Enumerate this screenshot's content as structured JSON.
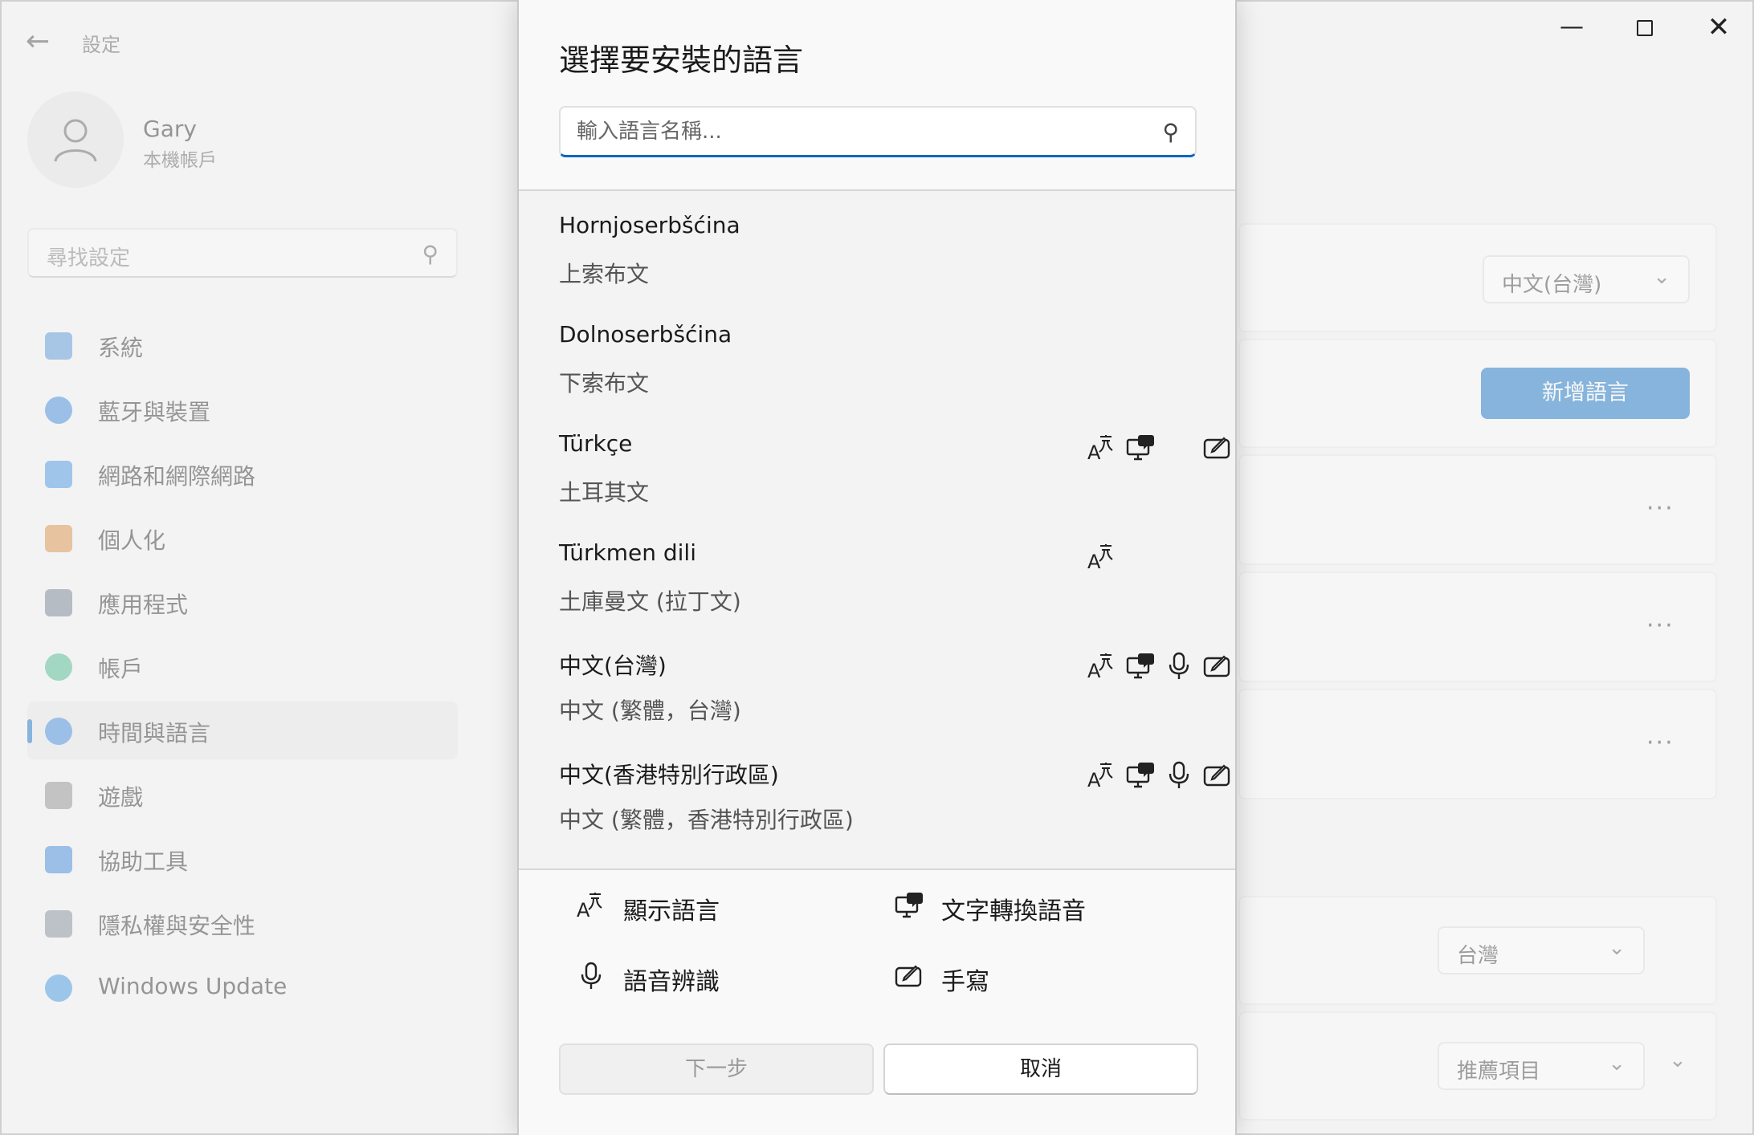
{
  "settings": {
    "title": "設定",
    "user": {
      "name": "Gary",
      "account": "本機帳戶"
    },
    "search_placeholder": "尋找設定",
    "nav": [
      {
        "label": "系統",
        "icon": "system-icon",
        "color": "#4a8fd6"
      },
      {
        "label": "藍牙與裝置",
        "icon": "bluetooth-icon",
        "color": "#2f7fd8"
      },
      {
        "label": "網路和網際網路",
        "icon": "wifi-icon",
        "color": "#3b8ee0"
      },
      {
        "label": "個人化",
        "icon": "brush-icon",
        "color": "#d88a3a"
      },
      {
        "label": "應用程式",
        "icon": "apps-icon",
        "color": "#6b7a8c"
      },
      {
        "label": "帳戶",
        "icon": "account-icon",
        "color": "#3fb58a"
      },
      {
        "label": "時間與語言",
        "icon": "time-language-icon",
        "color": "#2f7fd8"
      },
      {
        "label": "遊戲",
        "icon": "gamepad-icon",
        "color": "#8a8a8a"
      },
      {
        "label": "協助工具",
        "icon": "accessibility-icon",
        "color": "#2f7fd8"
      },
      {
        "label": "隱私權與安全性",
        "icon": "shield-icon",
        "color": "#7a8694"
      },
      {
        "label": "Windows Update",
        "icon": "update-icon",
        "color": "#2f8fe0"
      }
    ],
    "display_language_value": "中文(台灣)",
    "add_language_label": "新增語言",
    "region_value": "台灣",
    "format_value": "推薦項目",
    "more_label": "···"
  },
  "dialog": {
    "title": "選擇要安裝的語言",
    "search_placeholder": "輸入語言名稱...",
    "languages": [
      {
        "name": "Hornjoserbšćina",
        "sub": "上索布文",
        "features": []
      },
      {
        "name": "Dolnoserbšćina",
        "sub": "下索布文",
        "features": []
      },
      {
        "name": "Türkçe",
        "sub": "土耳其文",
        "features": [
          "display",
          "tts",
          "",
          "handwriting"
        ]
      },
      {
        "name": "Türkmen dili",
        "sub": "土庫曼文 (拉丁文)",
        "features": [
          "display"
        ]
      },
      {
        "name": "中文(台灣)",
        "sub": "中文 (繁體，台灣)",
        "features": [
          "display",
          "tts",
          "speech",
          "handwriting"
        ]
      },
      {
        "name": "中文(香港特別行政區)",
        "sub": "中文 (繁體，香港特別行政區)",
        "features": [
          "display",
          "tts",
          "speech",
          "handwriting"
        ]
      }
    ],
    "legend": {
      "display": "顯示語言",
      "tts": "文字轉換語音",
      "speech": "語音辨識",
      "handwriting": "手寫"
    },
    "next_label": "下一步",
    "cancel_label": "取消"
  },
  "colors": {
    "accent": "#0067c0"
  }
}
